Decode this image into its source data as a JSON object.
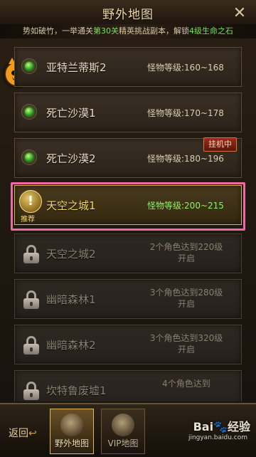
{
  "header": {
    "title": "野外地图",
    "close_label": "✕"
  },
  "banner": {
    "pre": "势如破竹，一举通关",
    "highlight1": "第30关",
    "mid": "精英挑战副本，解锁",
    "highlight2": "4级生命之石"
  },
  "maps": [
    {
      "name": "亚特兰蒂斯2",
      "level": "怪物等级:160~168",
      "state": "open"
    },
    {
      "name": "死亡沙漠1",
      "level": "怪物等级:170~178",
      "state": "open"
    },
    {
      "name": "死亡沙漠2",
      "level": "怪物等级:180~196",
      "state": "open",
      "badge": "挂机中"
    },
    {
      "name": "天空之城1",
      "level": "怪物等级:200~215",
      "state": "selected",
      "tag": "推荐"
    },
    {
      "name": "天空之城2",
      "unlock": "2个角色达到220级开启",
      "state": "locked"
    },
    {
      "name": "幽暗森林1",
      "unlock": "3个角色达到280级开启",
      "state": "locked"
    },
    {
      "name": "幽暗森林2",
      "unlock": "3个角色达到320级开启",
      "state": "locked"
    },
    {
      "name": "坎特鲁废墟1",
      "unlock": "4个角色达到",
      "state": "locked"
    }
  ],
  "nav": {
    "back_label": "返回",
    "tabs": [
      {
        "label": "野外地图",
        "active": true
      },
      {
        "label": "VIP地图",
        "active": false
      }
    ]
  },
  "watermark": {
    "brand": "Bai",
    "brand2": "经验",
    "url": "jingyan.baidu.com"
  },
  "colors": {
    "accent_green": "#79e05a",
    "highlight_pink": "#ef6aa4",
    "badge_red": "#9b2a1a"
  }
}
